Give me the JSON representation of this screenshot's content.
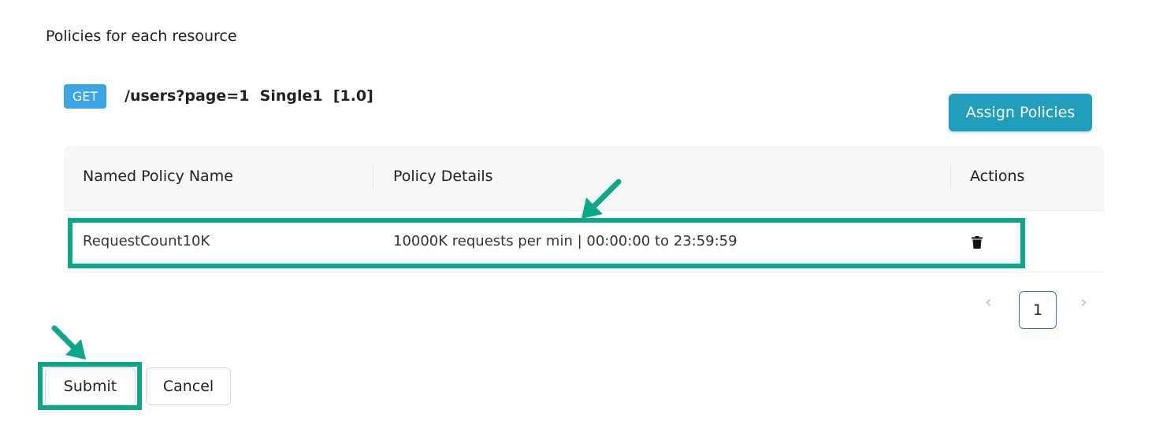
{
  "section": {
    "title": "Policies for each resource"
  },
  "resource": {
    "method": "GET",
    "path": "/users?page=1  Single1  [1.0]"
  },
  "assign_button": {
    "label": "Assign Policies"
  },
  "table": {
    "headers": [
      "Named Policy Name",
      "Policy Details",
      "Actions"
    ],
    "rows": [
      {
        "name": "RequestCount10K",
        "details": "10000K requests per min | 00:00:00 to 23:59:59",
        "action_icon": "trash-icon"
      }
    ]
  },
  "pagination": {
    "current_page": "1"
  },
  "footer": {
    "submit_label": "Submit",
    "cancel_label": "Cancel"
  },
  "colors": {
    "accent": "#219ebc",
    "badge": "#3aa6e8",
    "highlight": "#0aa888"
  }
}
